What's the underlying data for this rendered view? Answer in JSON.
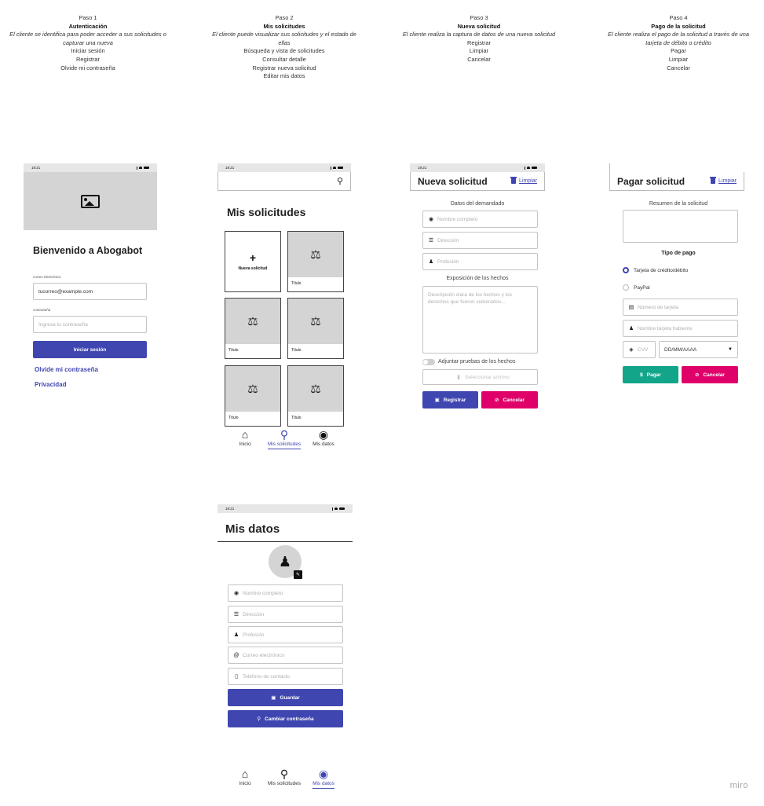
{
  "steps": [
    {
      "number": "Paso 1",
      "title": "Autenticación",
      "description": "El cliente se identifica para poder acceder a sus solicitudes o capturar una nueva",
      "items": [
        "Iniciar sesión",
        "Registrar",
        "Olvide mi contraseña"
      ]
    },
    {
      "number": "Paso 2",
      "title": "Mis solicitudes",
      "description": "El cliente puede visualizar sus solicitudes y el estado de ellas",
      "items": [
        "Búsqueda y vista de solicitudes",
        "Consultar detalle",
        "Registrar nueva solicitud",
        "Editar mis datos"
      ]
    },
    {
      "number": "Paso 3",
      "title": "Nueva solicitud",
      "description": "El cliente realiza la captura de datos de una nueva solicitud",
      "items": [
        "Registrar",
        "Limpiar",
        "Cancelar"
      ]
    },
    {
      "number": "Paso 4",
      "title": "Pago de la solicitud",
      "description": "El cliente realiza el pago de la solicitud a través de una tarjeta de débito o crédito",
      "items": [
        "Pagar",
        "Limpiar",
        "Cancelar"
      ]
    }
  ],
  "status_time": "19:21",
  "login": {
    "welcome": "Bienvenido a Abogabot",
    "email_label": "correo electrónico",
    "email_value": "tucorreo@example.com",
    "password_label": "contraseña",
    "password_placeholder": "Ingresa tu contraseña",
    "login_button": "Iniciar sesión",
    "forgot_link": "Olvide mi contraseña",
    "privacy_link": "Privacidad"
  },
  "requests": {
    "title": "Mis solicitudes",
    "new_card": "Nueva solicitud",
    "cards": [
      "Título",
      "Título",
      "Título",
      "Título",
      "Título"
    ]
  },
  "nav": [
    {
      "label": "Inicio",
      "icon": "home-icon"
    },
    {
      "label": "Mis solicitudes",
      "icon": "search-icon"
    },
    {
      "label": "Mis datos",
      "icon": "user-circle-icon"
    }
  ],
  "new_request": {
    "title": "Nueva solicitud",
    "clear": "Limpiar",
    "section_claimant": "Datos del demandado",
    "name_placeholder": "Nombre completo",
    "address_placeholder": "Dirección",
    "profession_placeholder": "Profesión",
    "section_facts": "Exposición de los hechos",
    "facts_placeholder": "Descripción clara de los hechos y los derechos que fueron vulnerados...",
    "attach_label": "Adjuntar pruebas de los hechos",
    "select_file": "Seleccionar archivo",
    "register_button": "Registrar",
    "cancel_button": "Cancelar"
  },
  "payment": {
    "title": "Pagar solicitud",
    "clear": "Limpiar",
    "summary_label": "Resumen de la solicitud",
    "payment_type": "Tipo de pago",
    "option_card": "Tarjeta de crédito/débito",
    "option_paypal": "PayPal",
    "card_number_placeholder": "Número de tarjeta",
    "cardholder_placeholder": "Nombre tarjeta habiente",
    "cvv_placeholder": "CVV",
    "expiry_value": "DD/MM/AAAA",
    "pay_button": "Pagar",
    "cancel_button": "Cancelar"
  },
  "profile": {
    "title": "Mis datos",
    "name_placeholder": "Nombre completo",
    "address_placeholder": "Dirección",
    "profession_placeholder": "Profesión",
    "email_placeholder": "Correo electrónico",
    "phone_placeholder": "Teléfono de contacto",
    "save_button": "Guardar",
    "change_password_button": "Cambiar contraseña"
  },
  "watermark": "miro",
  "colors": {
    "primary": "#4046b0",
    "danger": "#e0006a",
    "success": "#12a58a",
    "placeholder": "#d4d4d4"
  }
}
